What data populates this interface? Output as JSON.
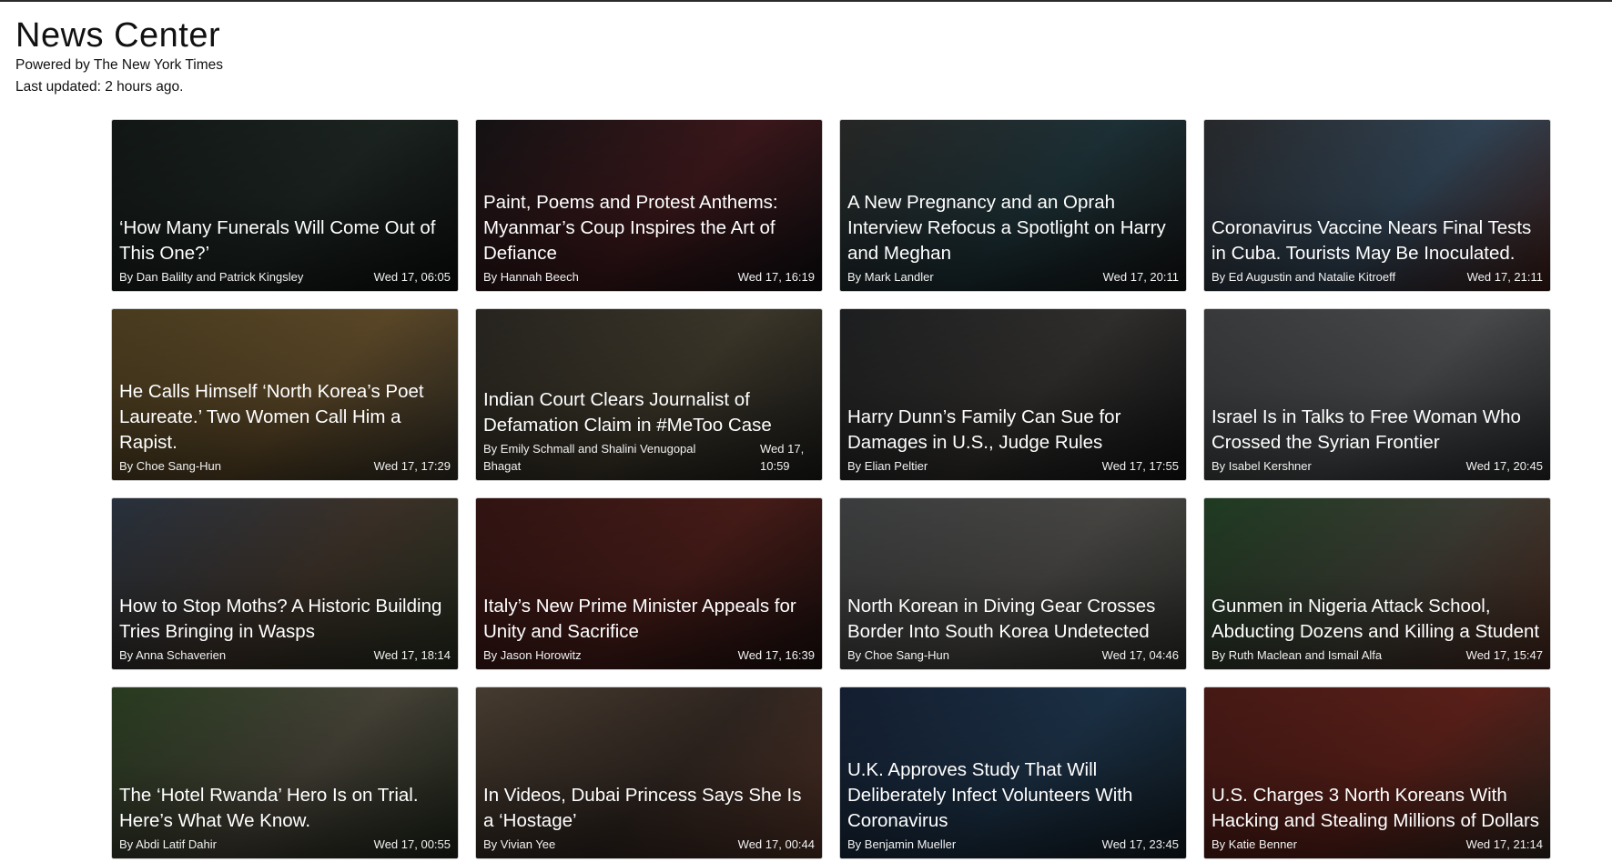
{
  "header": {
    "title": "News Center",
    "powered_by": "Powered by The New York Times",
    "last_updated": "Last updated: 2 hours ago."
  },
  "articles": [
    {
      "headline": "‘How Many Funerals Will Come Out of This One?’",
      "byline": "By Dan Balilty and Patrick Kingsley",
      "date": "Wed 17, 06:05",
      "image_colors": [
        "#1b2321",
        "#2a3631",
        "#121614"
      ]
    },
    {
      "headline": "Paint, Poems and Protest Anthems: Myanmar’s Coup Inspires the Art of Defiance",
      "byline": "By Hannah Beech",
      "date": "Wed 17, 16:19",
      "image_colors": [
        "#1e1b1e",
        "#5a2328",
        "#17151a"
      ]
    },
    {
      "headline": "A New Pregnancy and an Oprah Interview Refocus a Spotlight on Harry and Meghan",
      "byline": "By Mark Landler",
      "date": "Wed 17, 20:11",
      "image_colors": [
        "#3a3a38",
        "#2c4a52",
        "#1d1e1f"
      ]
    },
    {
      "headline": "Coronavirus Vaccine Nears Final Tests in Cuba. Tourists May Be Inoculated.",
      "byline": "By Ed Augustin and Natalie Kitroeff",
      "date": "Wed 17, 21:11",
      "image_colors": [
        "#3b3d40",
        "#4a6680",
        "#5a2a22"
      ]
    },
    {
      "headline": "He Calls Himself ‘North Korea’s Poet Laureate.’ Two Women Call Him a Rapist.",
      "byline": "By Choe Sang-Hun",
      "date": "Wed 17, 17:29",
      "image_colors": [
        "#6e5a2e",
        "#8a6c3c",
        "#4c4537"
      ]
    },
    {
      "headline": "Indian Court Clears Journalist of Defamation Claim in #MeToo Case",
      "byline": "By Emily Schmall and Shalini Venugopal Bhagat",
      "date": "Wed 17, 10:59",
      "image_colors": [
        "#3b3730",
        "#5b533f",
        "#2a2a27"
      ]
    },
    {
      "headline": "Harry Dunn’s Family Can Sue for Damages in U.S., Judge Rules",
      "byline": "By Elian Peltier",
      "date": "Wed 17, 17:55",
      "image_colors": [
        "#2c2e30",
        "#4a4744",
        "#1b1c1e"
      ]
    },
    {
      "headline": "Israel Is in Talks to Free Woman Who Crossed the Syrian Frontier",
      "byline": "By Isabel Kershner",
      "date": "Wed 17, 20:45",
      "image_colors": [
        "#55575a",
        "#6e7174",
        "#3c3e41"
      ]
    },
    {
      "headline": "How to Stop Moths? A Historic Building Tries Bringing in Wasps",
      "byline": "By Anna Schaverien",
      "date": "Wed 17, 18:14",
      "image_colors": [
        "#3d4a5c",
        "#5a4a3c",
        "#3a4630"
      ]
    },
    {
      "headline": "Italy’s New Prime Minister Appeals for Unity and Sacrifice",
      "byline": "By Jason Horowitz",
      "date": "Wed 17, 16:39",
      "image_colors": [
        "#4a1e1c",
        "#6a2a24",
        "#2a1716"
      ]
    },
    {
      "headline": "North Korean in Diving Gear Crosses Border Into South Korea Undetected",
      "byline": "By Choe Sang-Hun",
      "date": "Wed 17, 04:46",
      "image_colors": [
        "#5a5c5e",
        "#6c6a66",
        "#444640"
      ]
    },
    {
      "headline": "Gunmen in Nigeria Attack School, Abducting Dozens and Killing a Student",
      "byline": "By Ruth Maclean and Ismail Alfa",
      "date": "Wed 17, 15:47",
      "image_colors": [
        "#2f5a34",
        "#5a5a4e",
        "#6a3a2c"
      ]
    },
    {
      "headline": "The ‘Hotel Rwanda’ Hero Is on Trial. Here’s What We Know.",
      "byline": "By Abdi Latif Dahir",
      "date": "Wed 17, 00:55",
      "image_colors": [
        "#3c5a30",
        "#6a6454",
        "#2f3a28"
      ]
    },
    {
      "headline": "In Videos, Dubai Princess Says She Is a ‘Hostage’",
      "byline": "By Vivian Yee",
      "date": "Wed 17, 00:44",
      "image_colors": [
        "#6a5a48",
        "#4a3a32",
        "#7a4a3a"
      ]
    },
    {
      "headline": "U.K. Approves Study That Will Deliberately Infect Volunteers With Coronavirus",
      "byline": "By Benjamin Mueller",
      "date": "Wed 17, 23:45",
      "image_colors": [
        "#1e2e4a",
        "#2a4a6a",
        "#1a2a34"
      ]
    },
    {
      "headline": "U.S. Charges 3 North Koreans With Hacking and Stealing Millions of Dollars",
      "byline": "By Katie Benner",
      "date": "Wed 17, 21:14",
      "image_colors": [
        "#6a2620",
        "#8a3026",
        "#4a3a30"
      ]
    }
  ]
}
